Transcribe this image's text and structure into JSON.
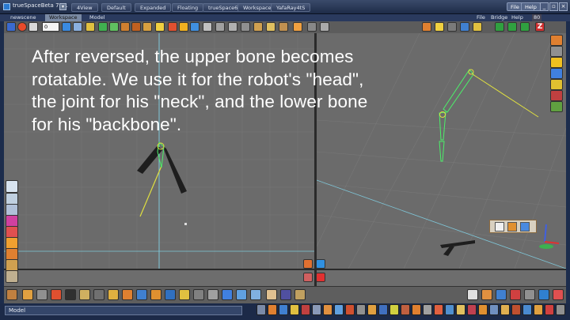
{
  "app": {
    "title": "trueSpaceBeta 7.61"
  },
  "workspace_tabs": [
    "4View",
    "Default",
    "Expanded",
    "Floating",
    "trueSpace6",
    "Workspace",
    "YafaRay4tS"
  ],
  "title_menu": {
    "file": "File",
    "help": "Help"
  },
  "doc_tabs": [
    "newscene",
    "Workspace",
    "Model"
  ],
  "doc_menu": [
    "File",
    "Bridge",
    "Help"
  ],
  "frame_field": {
    "value": "0"
  },
  "zoom_readout": "80",
  "caption": {
    "lines": [
      "After reversed, the upper bone becomes",
      "rotatable. We use it for the robot's \"head\",",
      "the joint for his \"neck\", and the lower bone",
      "for his \"backbone\"."
    ]
  },
  "statusbar": {
    "mode": "Model"
  },
  "colors": {
    "viewport_bg": "#6b6b6b",
    "grid": "#787878",
    "bone_selected": "#4cf06a",
    "bone_dark": "#1e1e1e",
    "ik_line": "#e0e040",
    "axis_y": "#7fc7d9",
    "chrome": "#1c2c4c"
  },
  "icons": {
    "left_tools": [
      "select-icon",
      "rotate-icon",
      "scale-icon",
      "cone-icon",
      "material-icon",
      "light-icon",
      "paint-icon",
      "gear-icon",
      "object-icon",
      "brush-icon"
    ],
    "right_tools": [
      "orange-cube-icon",
      "yellow-icon",
      "sphere-icon",
      "hdri-icon",
      "lightbulb-icon",
      "material-ball-icon",
      "green-icon",
      "camera-icon",
      "plant-icon"
    ],
    "top_tools": [
      "play-icon",
      "stop-icon",
      "rewind-icon",
      "frame-field",
      "forward-icon",
      "end-icon",
      "keyframe-icon",
      "curve-icon",
      "record-icon",
      "bone-icon",
      "skin-icon",
      "camera-icon",
      "light-icon",
      "ball-icon",
      "wand-icon",
      "arrow-up-icon",
      "arrow-down-icon"
    ],
    "viewport_tools": [
      "orange-cube-icon",
      "box-icon",
      "box-icon",
      "wire-icon",
      "axis-icon",
      "axis-icon",
      "axis-icon",
      "z-icon"
    ]
  }
}
